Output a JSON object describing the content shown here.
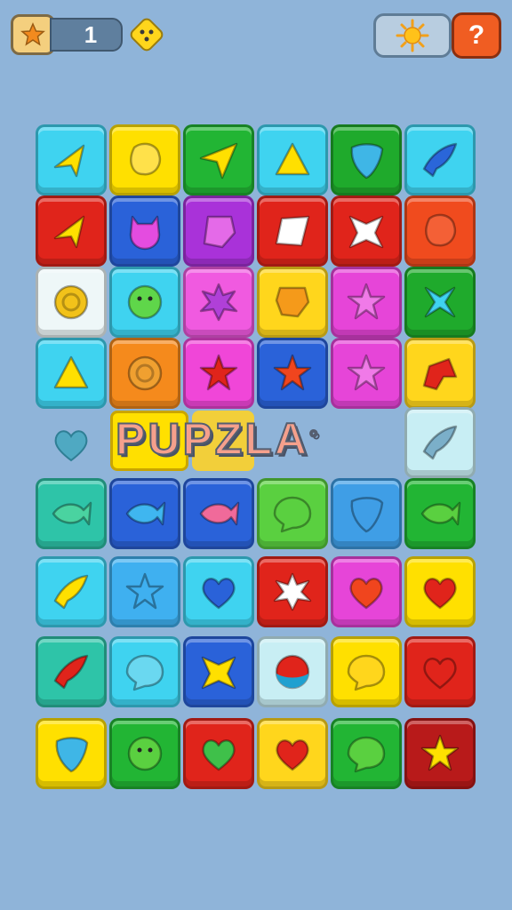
{
  "header": {
    "counter_value": "1",
    "help_label": "?",
    "star_icon": "star-badge-icon",
    "dice_icon": "dice-icon",
    "sun_icon": "sun-icon"
  },
  "title": {
    "text": "PUPZLA",
    "mark": "°"
  },
  "floating_piece": {
    "shape": "heart",
    "color": "#4fa9c2"
  },
  "board": {
    "rows": [
      [
        {
          "bg": "#3fd3f0",
          "shape": "arrow",
          "fg": "#ffe000"
        },
        {
          "bg": "#ffe000",
          "shape": "blob",
          "fg": "#ffe14a"
        },
        {
          "bg": "#22b534",
          "shape": "plane",
          "fg": "#ffe000"
        },
        {
          "bg": "#3fd3f0",
          "shape": "triangle",
          "fg": "#ffe000"
        },
        {
          "bg": "#1faa2c",
          "shape": "drop",
          "fg": "#3fb6e6"
        },
        {
          "bg": "#3fd3f0",
          "shape": "bird",
          "fg": "#2a66d9"
        }
      ],
      [
        {
          "bg": "#e0241b",
          "shape": "arrow",
          "fg": "#ffe000"
        },
        {
          "bg": "#2a62d9",
          "shape": "cat",
          "fg": "#e44ce0"
        },
        {
          "bg": "#a932d9",
          "shape": "gem",
          "fg": "#e46ae8"
        },
        {
          "bg": "#e0241b",
          "shape": "diamond",
          "fg": "#ffffff"
        },
        {
          "bg": "#e0241b",
          "shape": "bow",
          "fg": "#ffffff"
        },
        {
          "bg": "#f04b1e",
          "shape": "blob",
          "fg": "#f46036"
        }
      ],
      [
        {
          "bg": "#eef7f8",
          "shape": "ring",
          "fg": "#f2c21a"
        },
        {
          "bg": "#3fd3f0",
          "shape": "circle",
          "fg": "#5fd64a"
        },
        {
          "bg": "#f05ae0",
          "shape": "splat",
          "fg": "#b040d8"
        },
        {
          "bg": "#ffd61c",
          "shape": "shield",
          "fg": "#f59a1a"
        },
        {
          "bg": "#e645d8",
          "shape": "star",
          "fg": "#f07ae8"
        },
        {
          "bg": "#1faa2c",
          "shape": "cross",
          "fg": "#3fd3f0"
        }
      ],
      [
        {
          "bg": "#3fd3f0",
          "shape": "triangle",
          "fg": "#ffe000"
        },
        {
          "bg": "#f58a1c",
          "shape": "ring",
          "fg": "#f0a030"
        },
        {
          "bg": "#f046d8",
          "shape": "star",
          "fg": "#e0241b"
        },
        {
          "bg": "#2a62d9",
          "shape": "star",
          "fg": "#f0451e"
        },
        {
          "bg": "#e645d8",
          "shape": "star",
          "fg": "#f07ae8"
        },
        {
          "bg": "#ffd61c",
          "shape": "hat",
          "fg": "#e0241b"
        }
      ],
      [
        null,
        null,
        null,
        null,
        null,
        {
          "bg": "#c8eef4",
          "shape": "bird",
          "fg": "#7bafc9"
        }
      ],
      [
        {
          "bg": "#2ec4a8",
          "shape": "fish",
          "fg": "#4ad3a0"
        },
        {
          "bg": "#2a62d9",
          "shape": "fish",
          "fg": "#3fb6f0"
        },
        {
          "bg": "#2a62d9",
          "shape": "fish",
          "fg": "#f06a9a"
        },
        {
          "bg": "#5ad040",
          "shape": "bubble",
          "fg": "#5ad040"
        },
        {
          "bg": "#3f9ee6",
          "shape": "drop",
          "fg": "#3f9ee6"
        },
        {
          "bg": "#22b534",
          "shape": "fish",
          "fg": "#5ad040"
        }
      ],
      [
        {
          "bg": "#3fd3f0",
          "shape": "bird",
          "fg": "#ffe000"
        },
        {
          "bg": "#3fb0f0",
          "shape": "star",
          "fg": "#3fb0f0"
        },
        {
          "bg": "#3fd3f0",
          "shape": "heart",
          "fg": "#2a62d9"
        },
        {
          "bg": "#e0241b",
          "shape": "splat",
          "fg": "#ffffff"
        },
        {
          "bg": "#e645d8",
          "shape": "heart",
          "fg": "#f0451e"
        },
        {
          "bg": "#ffe000",
          "shape": "heart",
          "fg": "#e0241b"
        }
      ],
      [
        {
          "bg": "#2ec4a8",
          "shape": "bird",
          "fg": "#e0241b"
        },
        {
          "bg": "#3fd3f0",
          "shape": "bubble",
          "fg": "#6ad8f0"
        },
        {
          "bg": "#2a62d9",
          "shape": "bow",
          "fg": "#ffe000"
        },
        {
          "bg": "#c8eef4",
          "shape": "ball",
          "fg": "#e0241b"
        },
        {
          "bg": "#ffe000",
          "shape": "bubble",
          "fg": "#ffd61c"
        },
        {
          "bg": "#e0241b",
          "shape": "heart",
          "fg": "#e0241b"
        }
      ],
      [
        {
          "bg": "#ffe000",
          "shape": "drop",
          "fg": "#3fb6e6"
        },
        {
          "bg": "#22b534",
          "shape": "circle",
          "fg": "#5ad040"
        },
        {
          "bg": "#e0241b",
          "shape": "heart",
          "fg": "#3fc04a"
        },
        {
          "bg": "#ffd61c",
          "shape": "heart",
          "fg": "#e0241b"
        },
        {
          "bg": "#22b534",
          "shape": "bubble",
          "fg": "#5ad040"
        },
        {
          "bg": "#b81a1a",
          "shape": "star",
          "fg": "#ffe000"
        }
      ]
    ]
  }
}
